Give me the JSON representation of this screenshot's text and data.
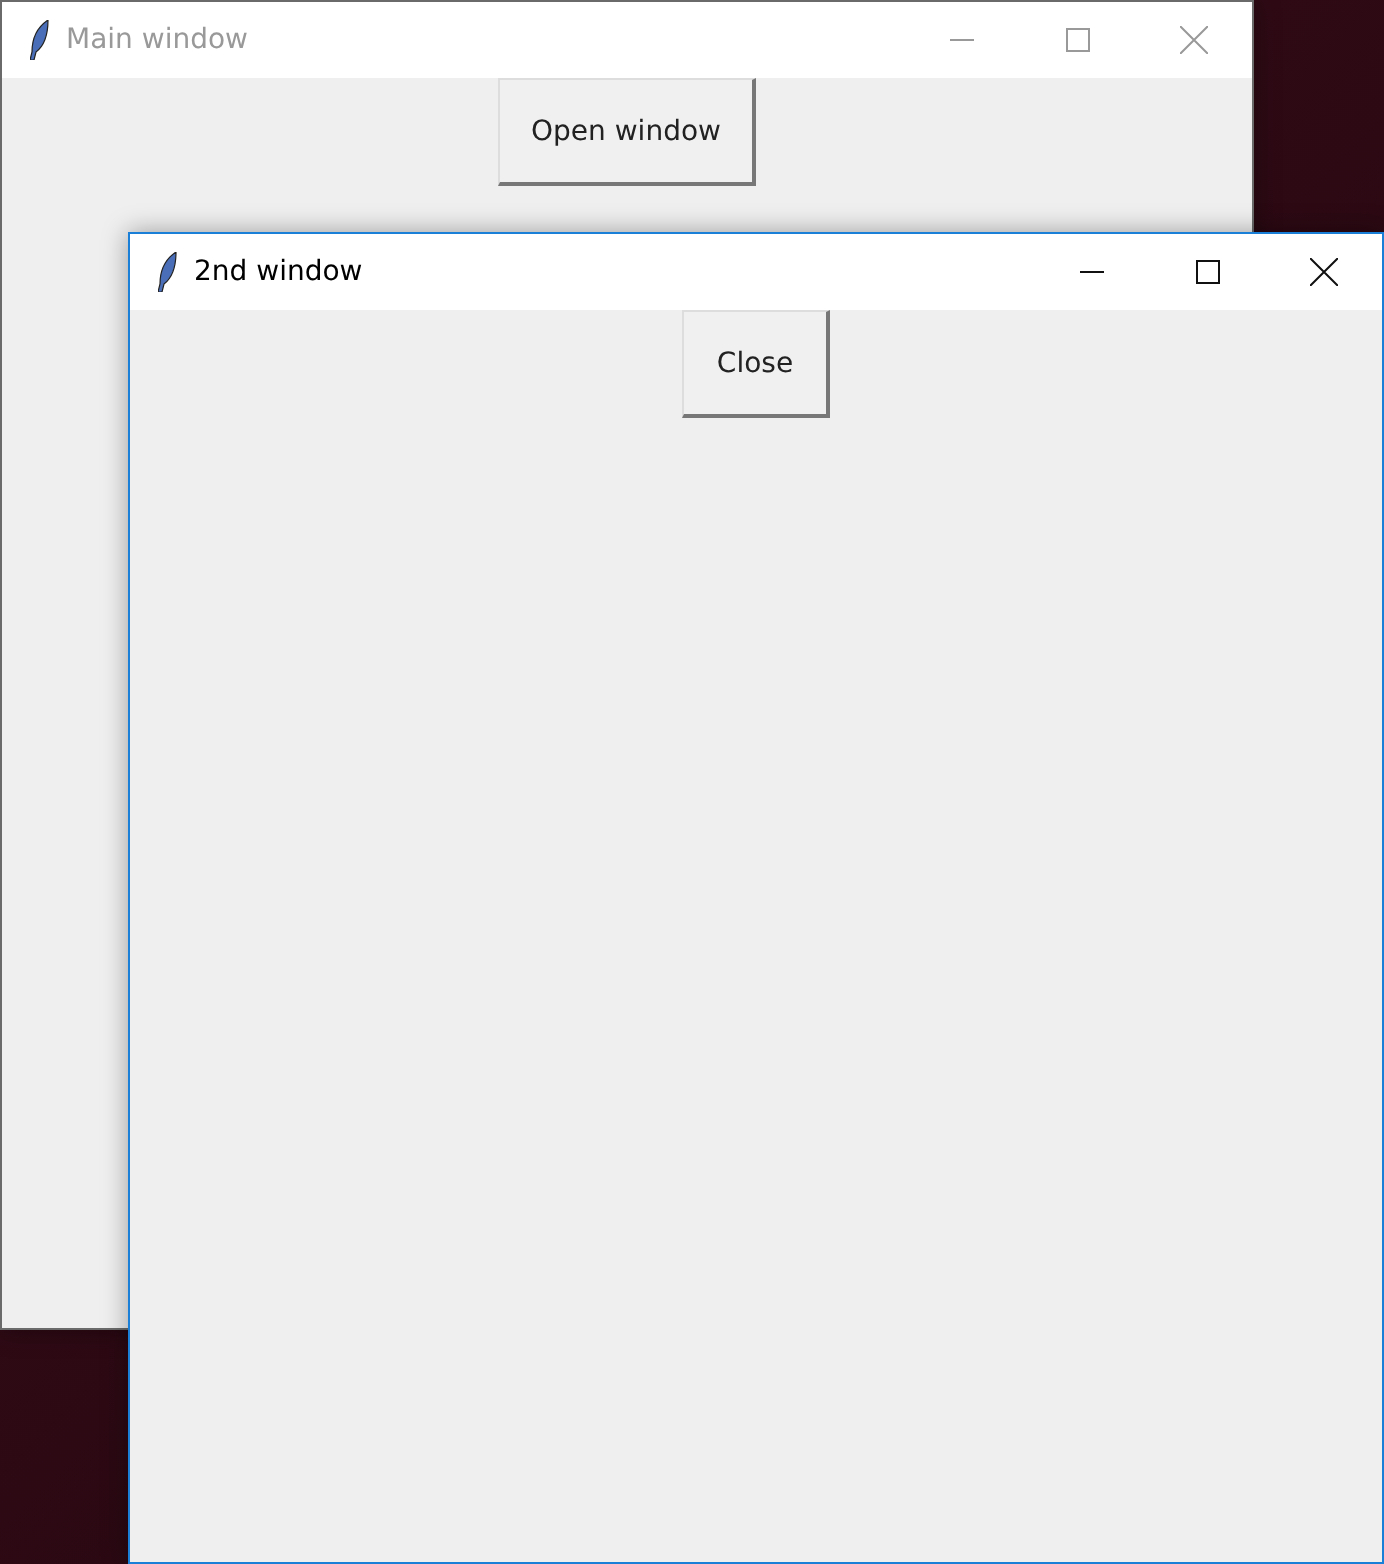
{
  "windows": [
    {
      "title": "Main window",
      "active": false,
      "button": "Open window"
    },
    {
      "title": "2nd window",
      "active": true,
      "button": "Close"
    }
  ]
}
